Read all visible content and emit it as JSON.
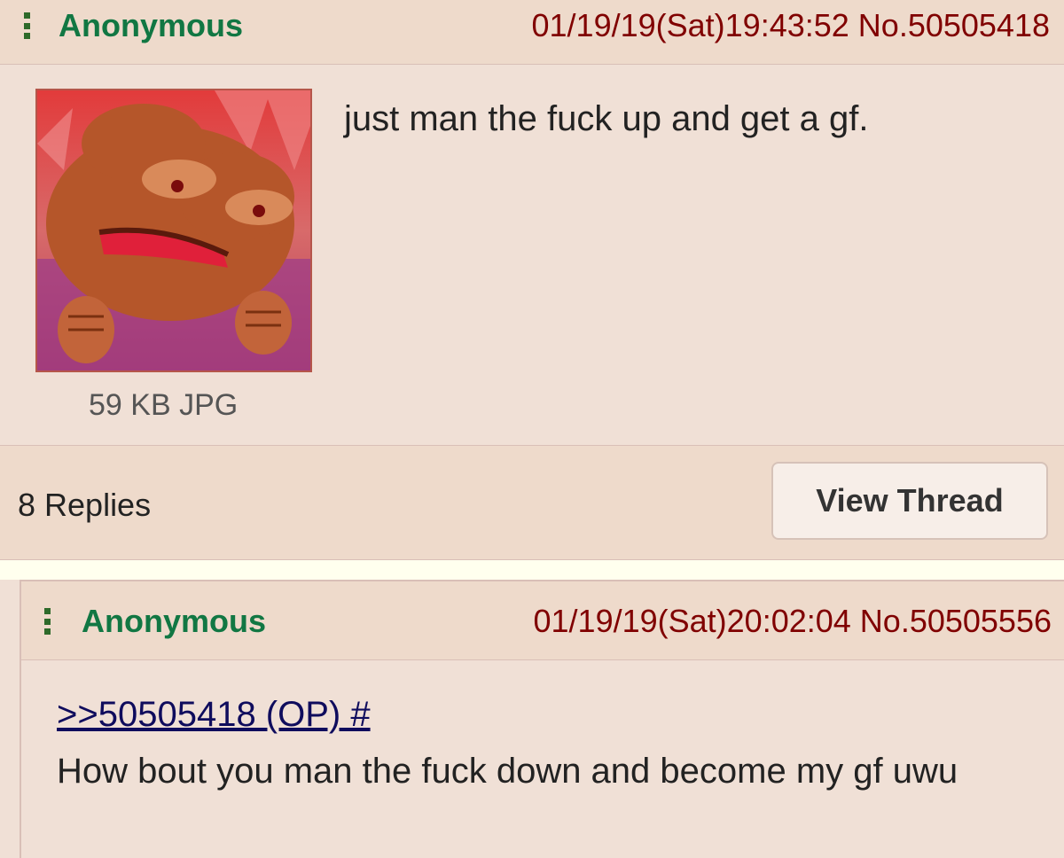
{
  "op": {
    "name": "Anonymous",
    "meta": "01/19/19(Sat)19:43:52 No.50505418",
    "text": "just man the fuck up and get a gf.",
    "file_info": "59 KB JPG",
    "replies": "8 Replies",
    "view_thread_label": "View Thread"
  },
  "reply": {
    "name": "Anonymous",
    "meta": "01/19/19(Sat)20:02:04 No.50505556",
    "quote_link": ">>50505418 (OP) #",
    "text": "How bout you man the fuck down and become my gf uwu"
  },
  "colors": {
    "background": "#f0e0d6",
    "header_bg": "#eedacb",
    "name_green": "#117743",
    "link_blue": "#0f0c5d"
  },
  "icons": {
    "menu": "vertical-dots-menu-icon",
    "thumbnail": "frog-image-thumbnail"
  }
}
